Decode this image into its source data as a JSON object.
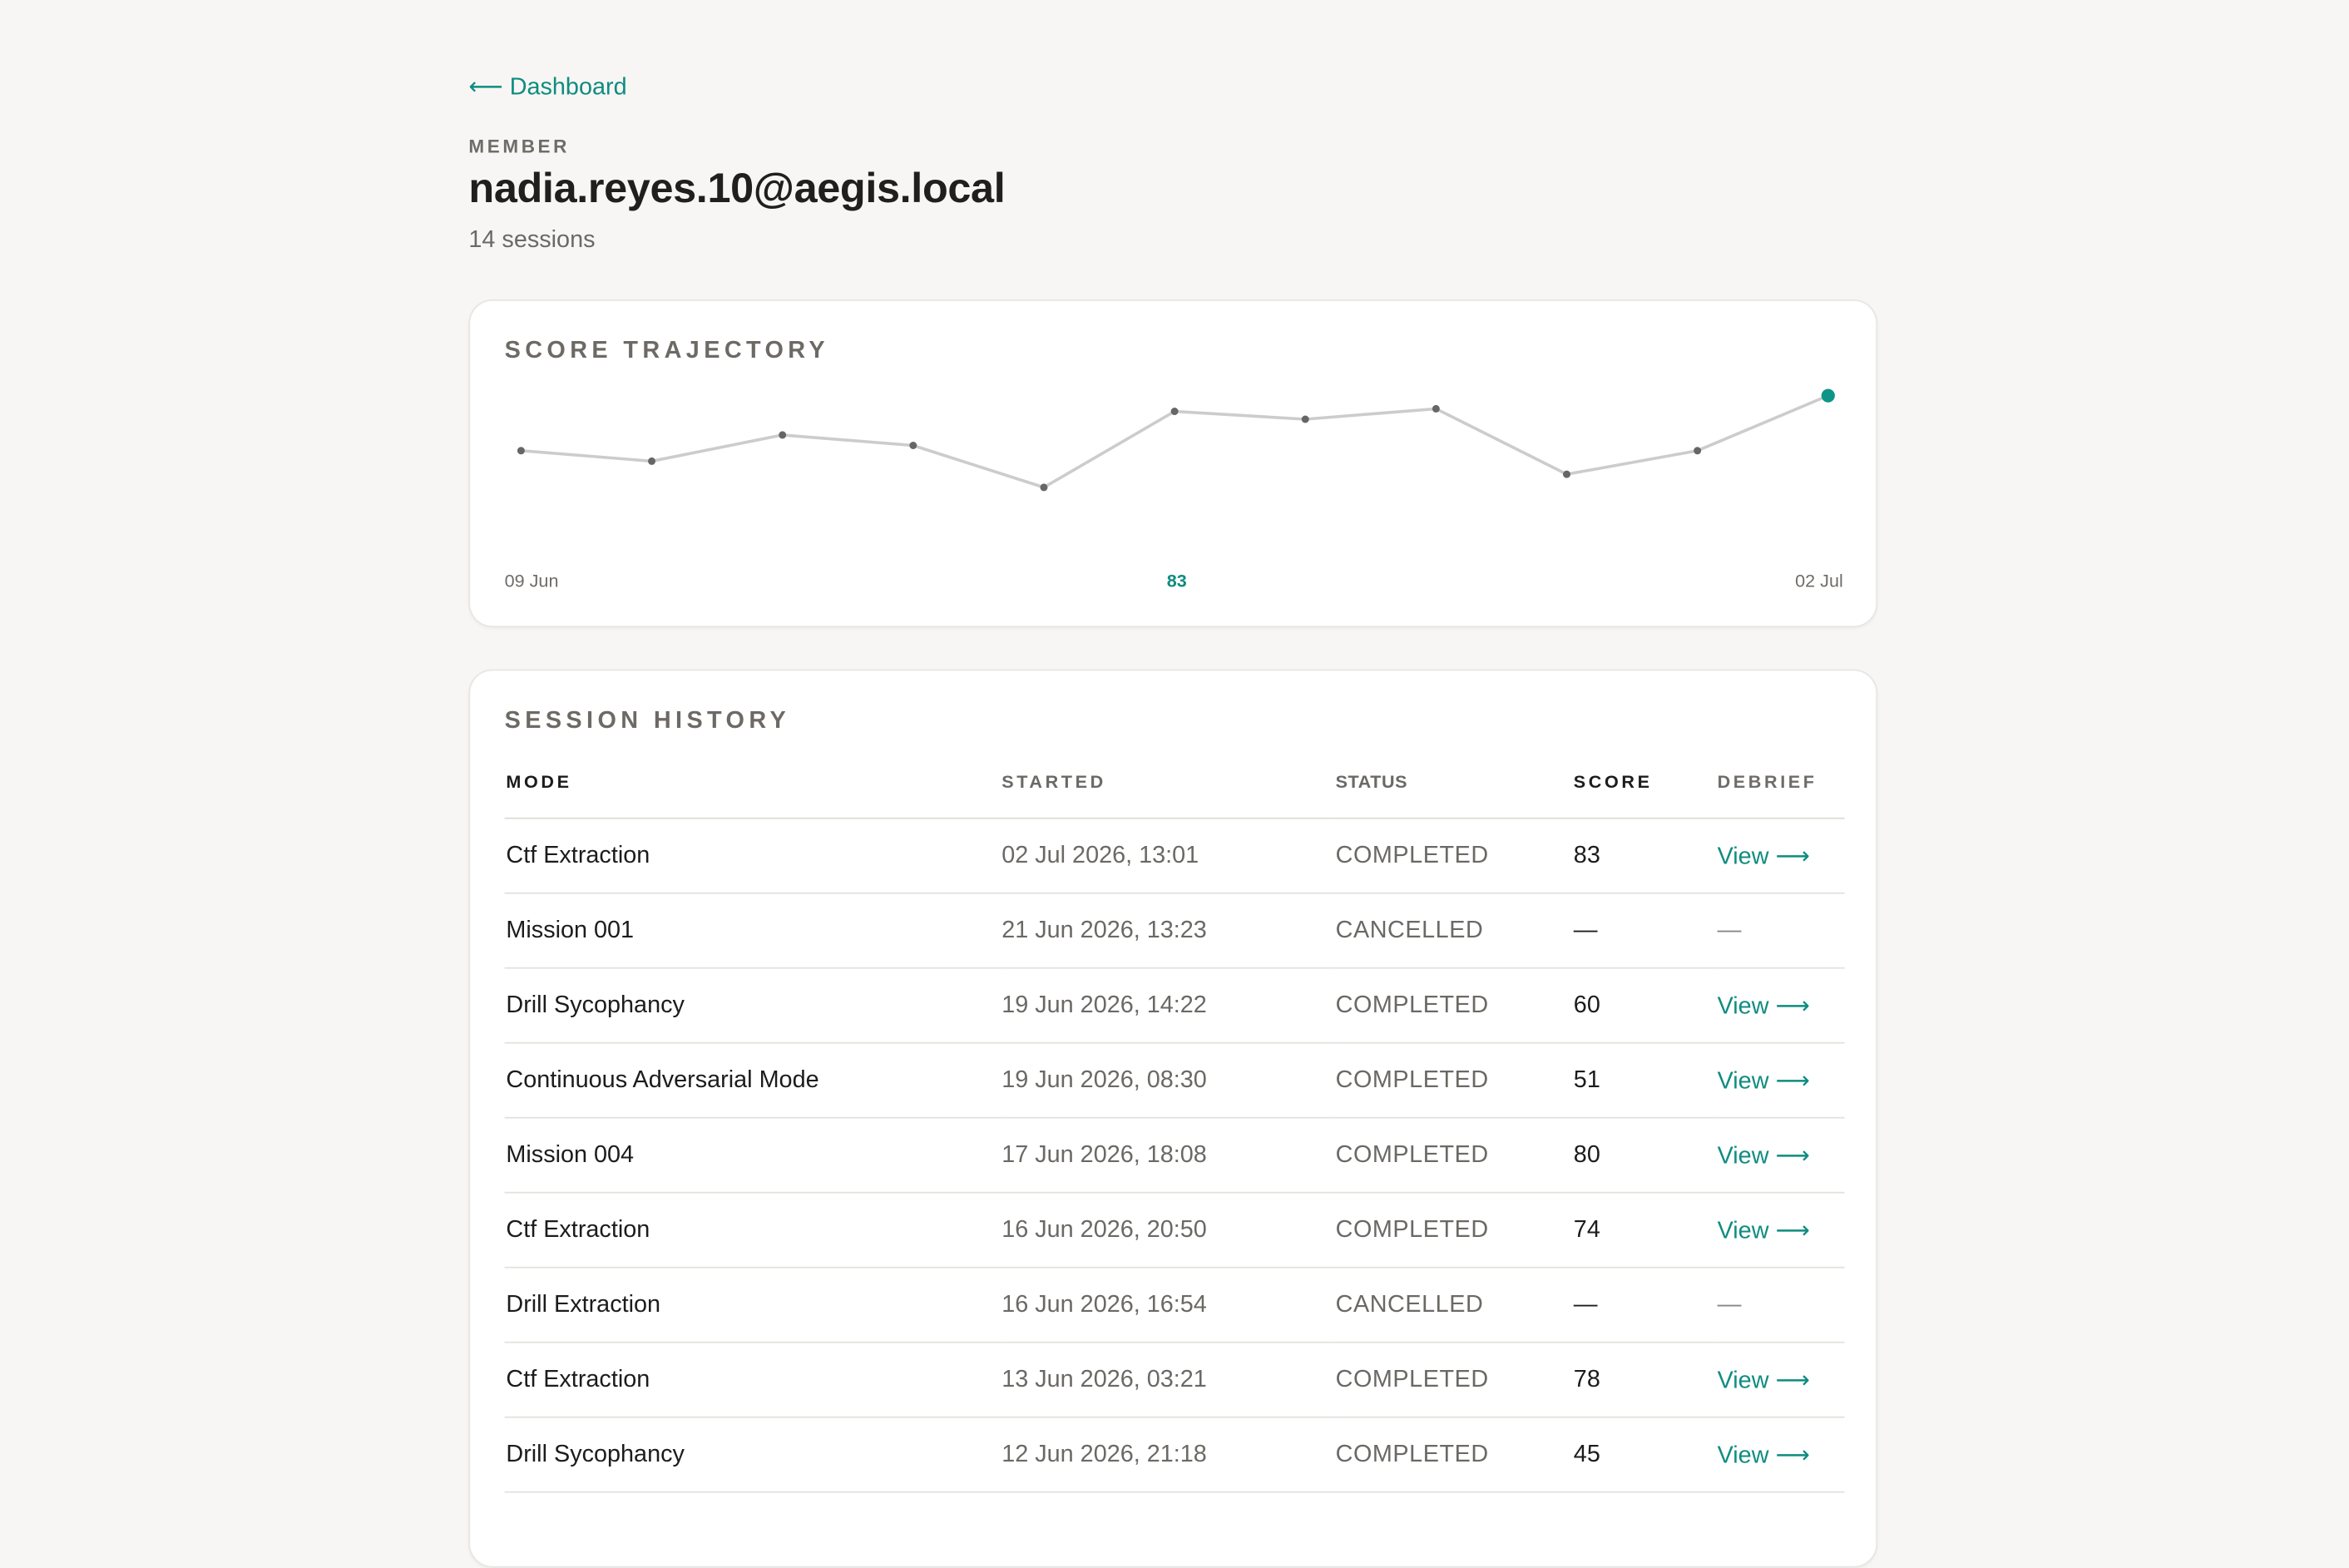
{
  "nav": {
    "back_label": "⟵ Dashboard"
  },
  "header": {
    "eyebrow": "MEMBER",
    "title": "nadia.reyes.10@aegis.local",
    "subtitle": "14 sessions"
  },
  "trajectory": {
    "title": "SCORE TRAJECTORY",
    "start_label": "09 Jun",
    "mid_label": "83",
    "end_label": "02 Jul"
  },
  "chart_data": {
    "type": "line",
    "title": "SCORE TRAJECTORY",
    "x": [
      "09 Jun",
      "",
      "",
      "",
      "",
      "",
      "",
      "",
      "",
      "",
      "02 Jul"
    ],
    "series": [
      {
        "values": [
          66,
          62,
          72,
          68,
          52,
          81,
          78,
          82,
          57,
          66,
          87
        ]
      }
    ],
    "highlight_last": true,
    "highlight_label": "83",
    "ylim": [
      0,
      100
    ],
    "grid": false,
    "colors": {
      "line": "#cccccc",
      "point": "#666666",
      "highlight": "#0f9488"
    }
  },
  "history": {
    "title": "SESSION HISTORY",
    "columns": [
      "MODE",
      "STARTED",
      "STATUS",
      "SCORE",
      "DEBRIEF"
    ],
    "rows": [
      {
        "mode": "Ctf Extraction",
        "started": "02 Jul 2026, 13:01",
        "status": "COMPLETED",
        "score": "83",
        "debrief": "View ⟶"
      },
      {
        "mode": "Mission 001",
        "started": "21 Jun 2026, 13:23",
        "status": "CANCELLED",
        "score": "—",
        "debrief": "—"
      },
      {
        "mode": "Drill Sycophancy",
        "started": "19 Jun 2026, 14:22",
        "status": "COMPLETED",
        "score": "60",
        "debrief": "View ⟶"
      },
      {
        "mode": "Continuous Adversarial Mode",
        "started": "19 Jun 2026, 08:30",
        "status": "COMPLETED",
        "score": "51",
        "debrief": "View ⟶"
      },
      {
        "mode": "Mission 004",
        "started": "17 Jun 2026, 18:08",
        "status": "COMPLETED",
        "score": "80",
        "debrief": "View ⟶"
      },
      {
        "mode": "Ctf Extraction",
        "started": "16 Jun 2026, 20:50",
        "status": "COMPLETED",
        "score": "74",
        "debrief": "View ⟶"
      },
      {
        "mode": "Drill Extraction",
        "started": "16 Jun 2026, 16:54",
        "status": "CANCELLED",
        "score": "—",
        "debrief": "—"
      },
      {
        "mode": "Ctf Extraction",
        "started": "13 Jun 2026, 03:21",
        "status": "COMPLETED",
        "score": "78",
        "debrief": "View ⟶"
      },
      {
        "mode": "Drill Sycophancy",
        "started": "12 Jun 2026, 21:18",
        "status": "COMPLETED",
        "score": "45",
        "debrief": "View ⟶"
      }
    ]
  },
  "colors": {
    "accent": "#0f8c80",
    "background": "#f7f6f4",
    "card": "#ffffff"
  }
}
